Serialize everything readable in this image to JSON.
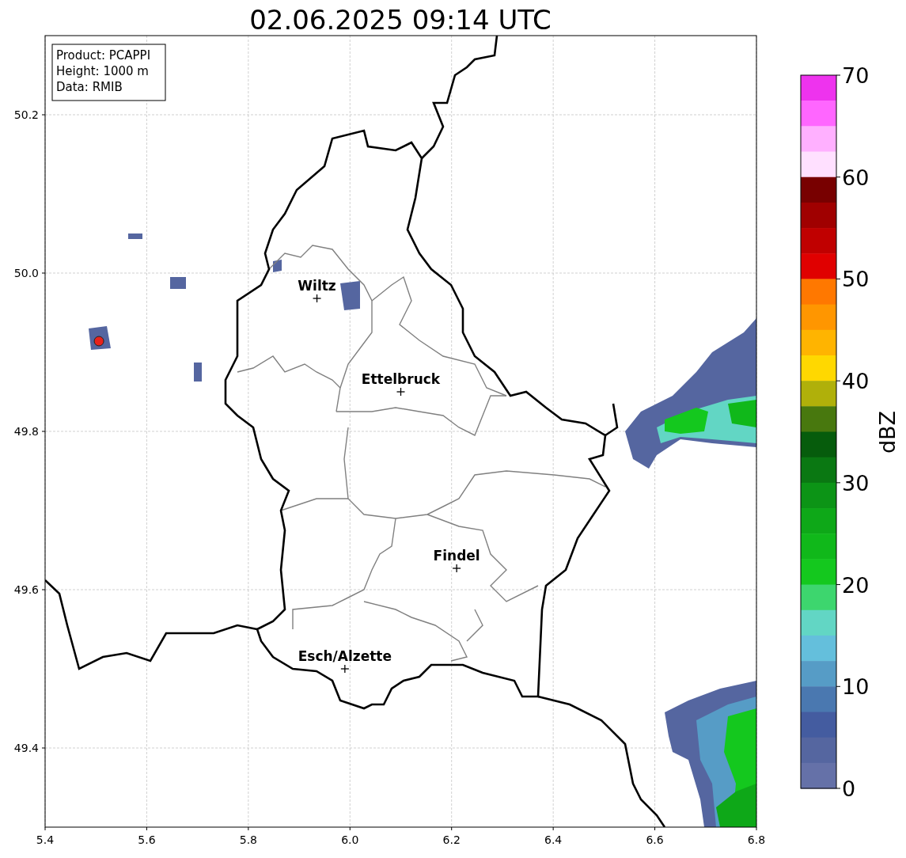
{
  "chart_data": {
    "type": "scatter",
    "title": "02.06.2025 09:14 UTC",
    "grid": true,
    "xlim": [
      5.4,
      6.8
    ],
    "ylim": [
      49.3,
      50.3
    ],
    "xticks": [
      {
        "value": 5.4,
        "label": "5.4"
      },
      {
        "value": 5.6,
        "label": "5.6"
      },
      {
        "value": 5.8,
        "label": "5.8"
      },
      {
        "value": 6.0,
        "label": "6.0"
      },
      {
        "value": 6.2,
        "label": "6.2"
      },
      {
        "value": 6.4,
        "label": "6.4"
      },
      {
        "value": 6.6,
        "label": "6.6"
      },
      {
        "value": 6.8,
        "label": "6.8"
      }
    ],
    "yticks": [
      {
        "value": 49.4,
        "label": "49.4"
      },
      {
        "value": 49.6,
        "label": "49.6"
      },
      {
        "value": 49.8,
        "label": "49.8"
      },
      {
        "value": 50.0,
        "label": "50.0"
      },
      {
        "value": 50.2,
        "label": "50.2"
      }
    ],
    "series": [
      {
        "color": "#000000",
        "x": [
          5.935,
          6.1,
          6.21,
          5.99
        ],
        "values": [
          49.968,
          49.85,
          49.627,
          49.5
        ]
      },
      {
        "color": "#e8221c",
        "x": [
          5.506
        ],
        "values": [
          49.914
        ]
      }
    ],
    "annotations": [
      {
        "text": "Wiltz",
        "x": 5.935,
        "y": 49.968
      },
      {
        "text": "Ettelbruck",
        "x": 6.1,
        "y": 49.85
      },
      {
        "text": "Findel",
        "x": 6.21,
        "y": 49.627
      },
      {
        "text": "Esch/Alzette",
        "x": 5.99,
        "y": 49.5
      }
    ]
  },
  "info_box": [
    "Product: PCAPPI",
    "Height: 1000 m",
    "Data: RMIB"
  ],
  "colorbar": {
    "label": "dBZ",
    "ticks": [
      "70",
      "60",
      "50",
      "40",
      "30",
      "20",
      "10",
      "0"
    ],
    "bins": [
      {
        "color": "#ee33ee"
      },
      {
        "color": "#ff66ff"
      },
      {
        "color": "#ffb0ff"
      },
      {
        "color": "#ffe0ff"
      },
      {
        "color": "#780000"
      },
      {
        "color": "#a00000"
      },
      {
        "color": "#c00000"
      },
      {
        "color": "#e00000"
      },
      {
        "color": "#ff7800"
      },
      {
        "color": "#ff9600"
      },
      {
        "color": "#ffb400"
      },
      {
        "color": "#ffd800"
      },
      {
        "color": "#b0b00a"
      },
      {
        "color": "#48780e"
      },
      {
        "color": "#065c0c"
      },
      {
        "color": "#0a7812"
      },
      {
        "color": "#0c9416"
      },
      {
        "color": "#0ea818"
      },
      {
        "color": "#10b81a"
      },
      {
        "color": "#14c81e"
      },
      {
        "color": "#3dd66e"
      },
      {
        "color": "#62d6c4"
      },
      {
        "color": "#64bfdc"
      },
      {
        "color": "#569cc6"
      },
      {
        "color": "#4a78b0"
      },
      {
        "color": "#445ca0"
      },
      {
        "color": "#5566a0"
      },
      {
        "color": "#6571a8"
      }
    ]
  }
}
